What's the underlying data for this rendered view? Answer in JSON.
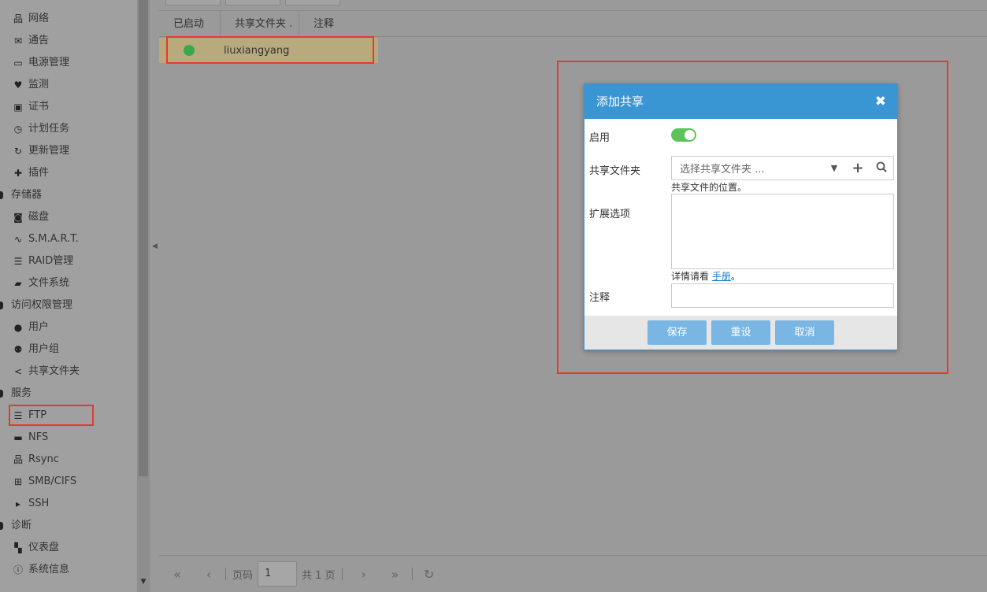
{
  "sidebar": {
    "items": [
      {
        "label": "网络",
        "icon": "network-icon",
        "glyph": "品",
        "kind": "sub"
      },
      {
        "label": "通告",
        "icon": "mail-icon",
        "glyph": "✉",
        "kind": "sub"
      },
      {
        "label": "电源管理",
        "icon": "battery-icon",
        "glyph": "▭",
        "kind": "sub"
      },
      {
        "label": "监测",
        "icon": "heartbeat-icon",
        "glyph": "♥",
        "kind": "sub"
      },
      {
        "label": "证书",
        "icon": "certificate-icon",
        "glyph": "▣",
        "kind": "sub"
      },
      {
        "label": "计划任务",
        "icon": "calendar-clock-icon",
        "glyph": "◷",
        "kind": "sub"
      },
      {
        "label": "更新管理",
        "icon": "refresh-icon",
        "glyph": "↻",
        "kind": "sub"
      },
      {
        "label": "插件",
        "icon": "puzzle-icon",
        "glyph": "✚",
        "kind": "sub"
      },
      {
        "label": "存储器",
        "icon": "",
        "glyph": "",
        "kind": "group"
      },
      {
        "label": "磁盘",
        "icon": "disk-icon",
        "glyph": "◙",
        "kind": "sub"
      },
      {
        "label": "S.M.A.R.T.",
        "icon": "pulse-icon",
        "glyph": "∿",
        "kind": "sub"
      },
      {
        "label": "RAID管理",
        "icon": "database-icon",
        "glyph": "☰",
        "kind": "sub"
      },
      {
        "label": "文件系统",
        "icon": "folder-icon",
        "glyph": "▰",
        "kind": "sub"
      },
      {
        "label": "访问权限管理",
        "icon": "",
        "glyph": "",
        "kind": "group"
      },
      {
        "label": "用户",
        "icon": "user-icon",
        "glyph": "●",
        "kind": "sub"
      },
      {
        "label": "用户组",
        "icon": "users-icon",
        "glyph": "⚉",
        "kind": "sub"
      },
      {
        "label": "共享文件夹",
        "icon": "share-icon",
        "glyph": "<",
        "kind": "sub"
      },
      {
        "label": "服务",
        "icon": "",
        "glyph": "",
        "kind": "group"
      },
      {
        "label": "FTP",
        "icon": "server-icon",
        "glyph": "☰",
        "kind": "sub"
      },
      {
        "label": "NFS",
        "icon": "desktop-icon",
        "glyph": "▬",
        "kind": "sub"
      },
      {
        "label": "Rsync",
        "icon": "sitemap-icon",
        "glyph": "品",
        "kind": "sub"
      },
      {
        "label": "SMB/CIFS",
        "icon": "windows-icon",
        "glyph": "⊞",
        "kind": "sub"
      },
      {
        "label": "SSH",
        "icon": "terminal-icon",
        "glyph": "▸",
        "kind": "sub"
      },
      {
        "label": "诊断",
        "icon": "",
        "glyph": "",
        "kind": "group"
      },
      {
        "label": "仪表盘",
        "icon": "dashboard-icon",
        "glyph": "▚",
        "kind": "sub"
      },
      {
        "label": "系统信息",
        "icon": "info-icon",
        "glyph": "ⓘ",
        "kind": "sub"
      }
    ]
  },
  "grid": {
    "columns": [
      "已启动",
      "共享文件夹",
      "注释"
    ],
    "rows": [
      {
        "enabled": true,
        "shared_folder": "liuxiangyang",
        "comment": ""
      }
    ]
  },
  "pager": {
    "page_label": "页码",
    "page_value": "1",
    "total_label": "共 1 页"
  },
  "modal": {
    "title": "添加共享",
    "close_glyph": "✖",
    "fields": {
      "enable_label": "启用",
      "enable_value": true,
      "shared_folder_label": "共享文件夹",
      "shared_folder_placeholder": "选择共享文件夹 ...",
      "shared_folder_hint": "共享文件的位置。",
      "extra_options_label": "扩展选项",
      "extra_options_hint_prefix": "详情请看",
      "extra_options_hint_link": "手册",
      "extra_options_hint_suffix": "。",
      "comment_label": "注释"
    },
    "buttons": {
      "save": "保存",
      "reset": "重设",
      "cancel": "取消"
    }
  },
  "colors": {
    "highlight": "#e53a2b",
    "modal_header": "#3a95d3",
    "toggle_on": "#5cc35c",
    "status_enabled": "#3aa84a"
  }
}
